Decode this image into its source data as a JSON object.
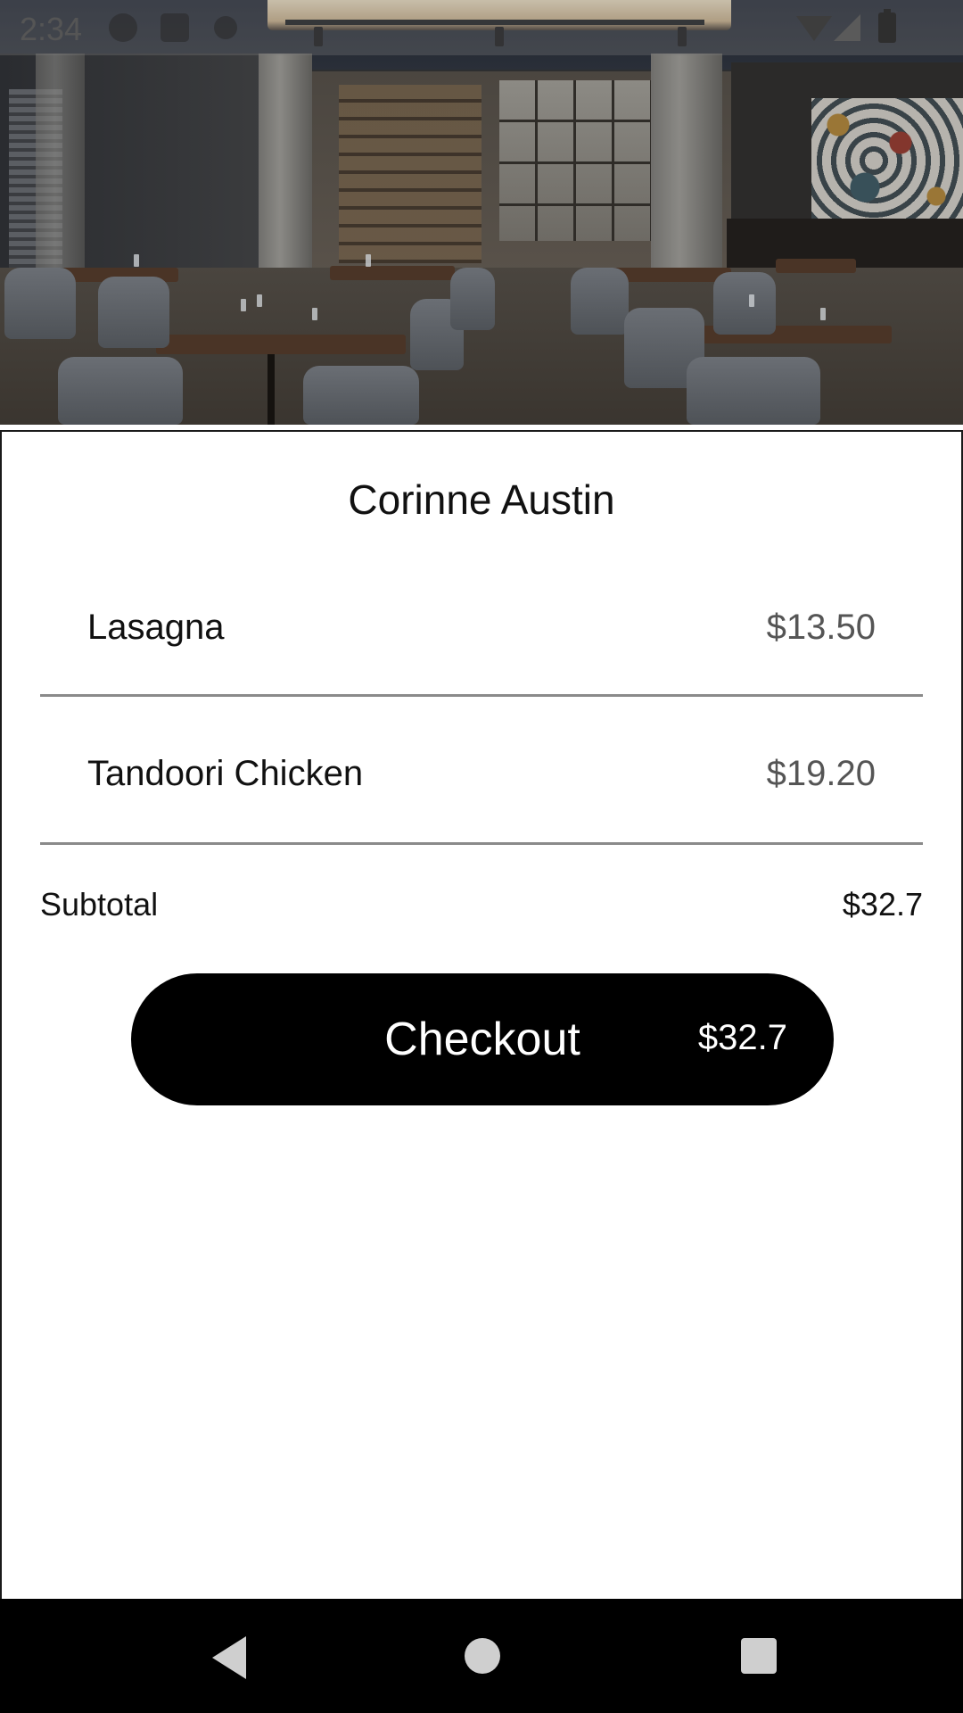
{
  "status_bar": {
    "time": "2:34"
  },
  "hero": {
    "image": "restaurant-interior-photo"
  },
  "cart": {
    "title": "Corinne Austin",
    "items": [
      {
        "name": "Lasagna",
        "price": "$13.50"
      },
      {
        "name": "Tandoori Chicken",
        "price": "$19.20"
      }
    ],
    "subtotal_label": "Subtotal",
    "subtotal_value": "$32.7"
  },
  "checkout": {
    "label": "Checkout",
    "amount": "$32.7"
  },
  "icons": {
    "wifi": "wifi-icon",
    "signal": "signal-icon",
    "battery": "battery-icon",
    "nav_back": "back-triangle-icon",
    "nav_home": "home-circle-icon",
    "nav_recents": "recents-square-icon"
  },
  "colors": {
    "checkout_bg": "#000000",
    "divider": "#8a8a8a",
    "price_text": "#555555"
  }
}
